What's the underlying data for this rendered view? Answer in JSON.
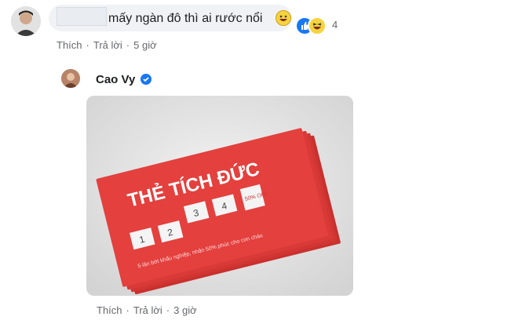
{
  "comment1": {
    "text": "mấy ngàn đô thì ai rước nổi",
    "reaction_count": "4",
    "actions": {
      "like": "Thích",
      "reply": "Trả lời",
      "time": "5 giờ"
    },
    "emoji": "grinning-face-icon"
  },
  "comment2": {
    "user_name": "Cao Vy",
    "verified": true,
    "card": {
      "title": "THẺ TÍCH ĐỨC",
      "boxes_top": [
        "3",
        "4"
      ],
      "boxes_bottom": [
        "1",
        "2"
      ],
      "discount": "50% OFF",
      "caption": "5 lần bớt khẩu nghiệp, nhận 50% phúc cho con cháu"
    },
    "actions": {
      "like": "Thích",
      "reply": "Trả lời",
      "time": "3 giờ"
    }
  },
  "colors": {
    "card_red": "#e3403e",
    "link_blue": "#1877f2",
    "bubble_bg": "#f0f2f5"
  }
}
